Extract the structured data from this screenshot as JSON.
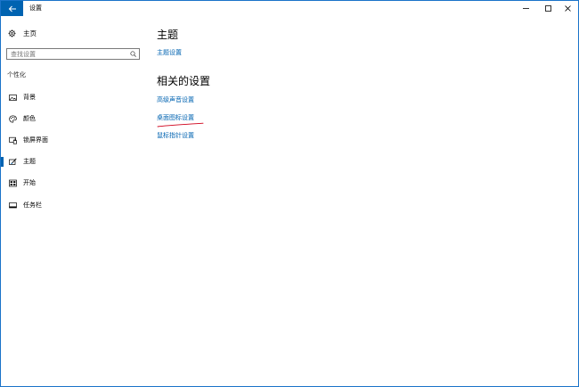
{
  "window": {
    "title": "设置"
  },
  "sidebar": {
    "home_label": "主页",
    "search_placeholder": "查找设置",
    "section_label": "个性化",
    "items": [
      {
        "label": "背景",
        "icon": "image-icon"
      },
      {
        "label": "颜色",
        "icon": "palette-icon"
      },
      {
        "label": "锁屏界面",
        "icon": "lock-screen-icon"
      },
      {
        "label": "主题",
        "icon": "theme-icon",
        "active": true
      },
      {
        "label": "开始",
        "icon": "start-menu-icon"
      },
      {
        "label": "任务栏",
        "icon": "taskbar-icon"
      }
    ]
  },
  "main": {
    "title": "主题",
    "theme_settings_link": "主题设置",
    "related_title": "相关的设置",
    "related_links": [
      "高级声音设置",
      "桌面图标设置",
      "鼠标指针设置"
    ]
  },
  "colors": {
    "accent": "#0063b1",
    "annotation": "#d0021b"
  }
}
